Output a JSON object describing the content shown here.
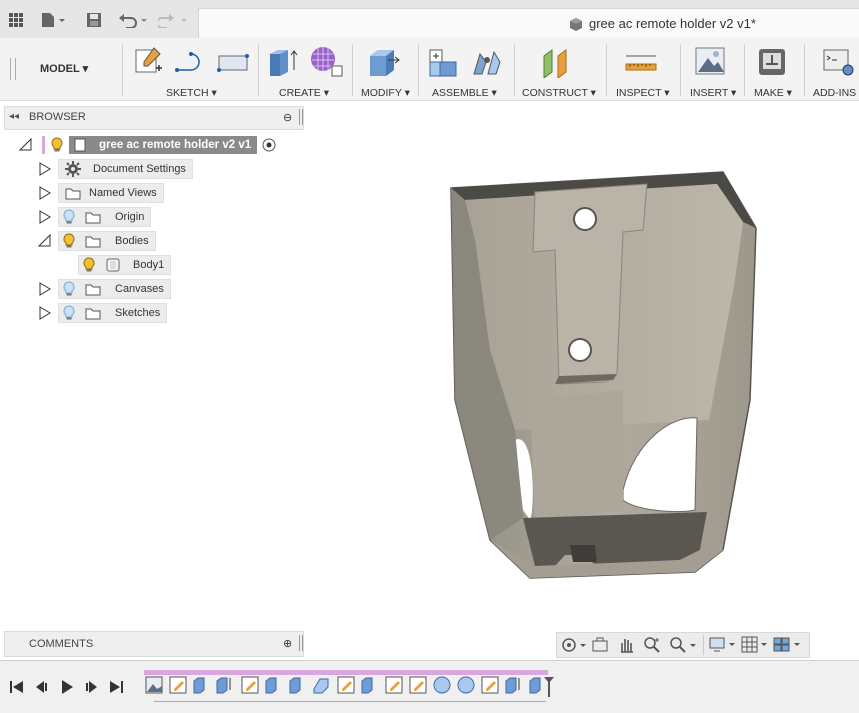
{
  "app": {
    "doc_title": "gree ac remote holder v2 v1*"
  },
  "toolbar": {
    "workspace": "MODEL",
    "groups": [
      "SKETCH",
      "CREATE",
      "MODIFY",
      "ASSEMBLE",
      "CONSTRUCT",
      "INSPECT",
      "INSERT",
      "MAKE",
      "ADD-INS"
    ]
  },
  "browser": {
    "title": "BROWSER",
    "root": "gree ac remote holder v2 v1",
    "items": [
      "Document Settings",
      "Named Views",
      "Origin",
      "Bodies",
      "Body1",
      "Canvases",
      "Sketches"
    ]
  },
  "comments": {
    "title": "COMMENTS"
  },
  "colors": {
    "accent": "#d9a6dd",
    "bulb": "#f2c12e",
    "bulb_off": "#6fa8dc",
    "body_gray": "#a8a397"
  }
}
